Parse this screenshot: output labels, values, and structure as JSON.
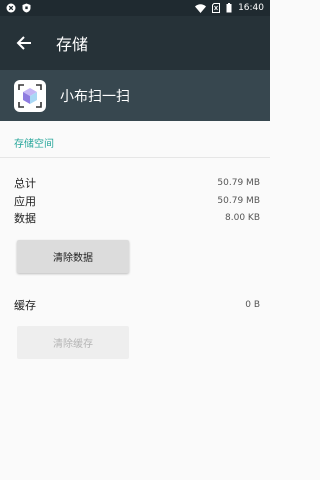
{
  "status_bar": {
    "time": "16:40",
    "left_icons": [
      "close-circle-icon",
      "shield-icon"
    ],
    "right_icons": [
      "wifi-icon",
      "no-sim-icon",
      "battery-icon"
    ]
  },
  "app_bar": {
    "title": "存储",
    "back_icon": "arrow-back-icon"
  },
  "app_header": {
    "name": "小布扫一扫",
    "icon": "scan-cube-icon"
  },
  "storage": {
    "section_title": "存储空间",
    "total_label": "总计",
    "total_value": "50.79 MB",
    "app_label": "应用",
    "app_value": "50.79 MB",
    "data_label": "数据",
    "data_value": "8.00 KB",
    "clear_data_button": "清除数据",
    "cache_label": "缓存",
    "cache_value": "0 B",
    "clear_cache_button": "清除缓存"
  }
}
